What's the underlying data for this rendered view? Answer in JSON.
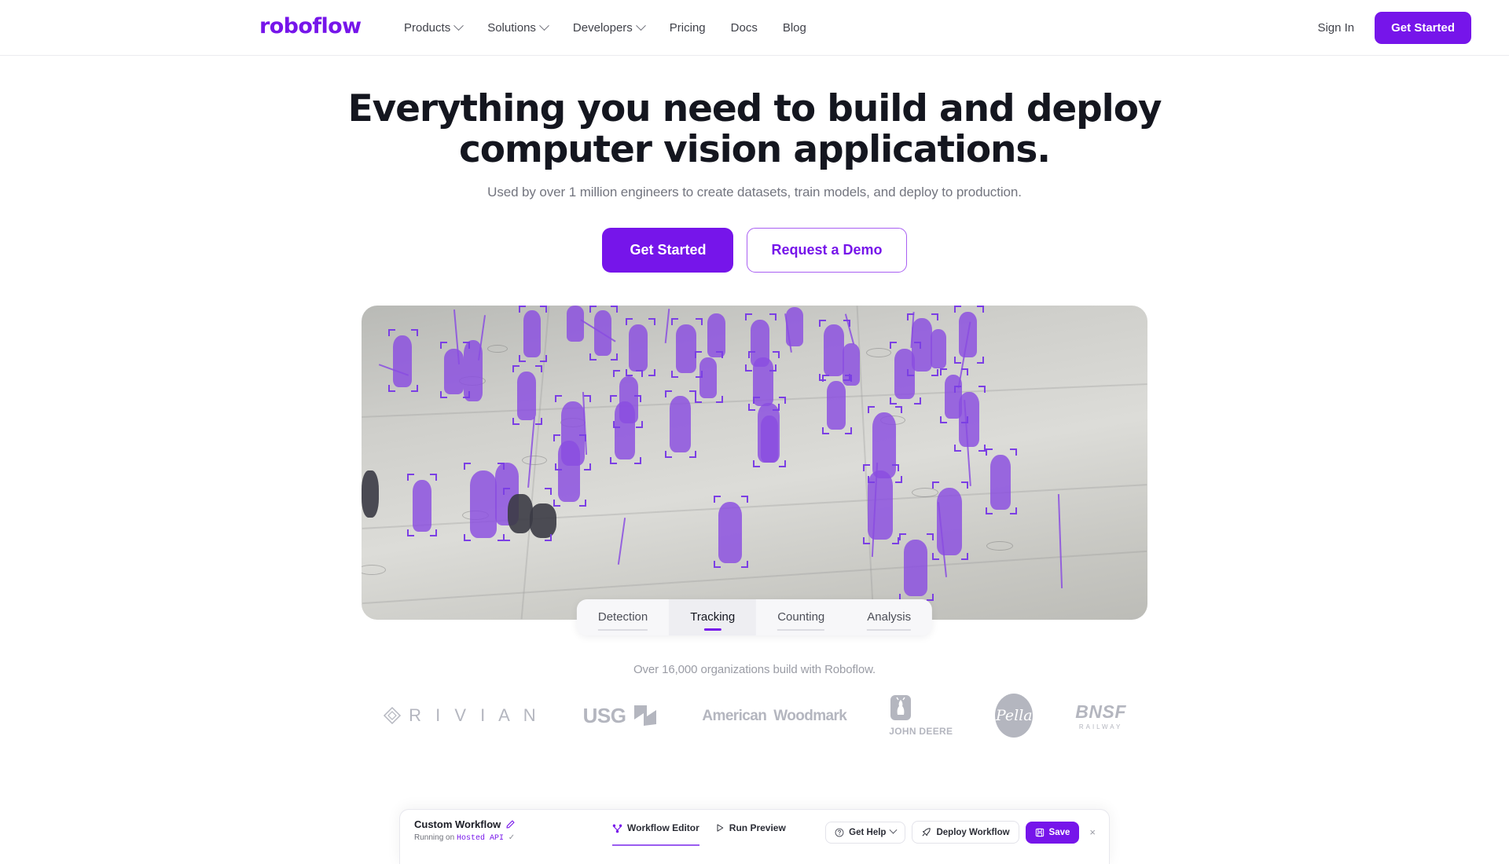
{
  "brand": {
    "logo_text": "roboflow",
    "accent": "#7615ea"
  },
  "nav": {
    "links": [
      {
        "label": "Products",
        "has_dropdown": true
      },
      {
        "label": "Solutions",
        "has_dropdown": true
      },
      {
        "label": "Developers",
        "has_dropdown": true
      },
      {
        "label": "Pricing",
        "has_dropdown": false
      },
      {
        "label": "Docs",
        "has_dropdown": false
      },
      {
        "label": "Blog",
        "has_dropdown": false
      }
    ],
    "sign_in": "Sign In",
    "get_started": "Get Started"
  },
  "hero": {
    "heading_line1": "Everything you need to build and deploy",
    "heading_line2": "computer vision applications.",
    "subheading": "Used by over 1 million engineers to create datasets, train models, and deploy to production.",
    "cta_primary": "Get Started",
    "cta_secondary": "Request a Demo"
  },
  "demo": {
    "tabs": [
      {
        "label": "Detection",
        "active": false
      },
      {
        "label": "Tracking",
        "active": true
      },
      {
        "label": "Counting",
        "active": false
      },
      {
        "label": "Analysis",
        "active": false
      }
    ],
    "scene_description": "Overhead surveillance view of a plaza with people segmented in purple and tracked with corner bounding boxes and motion trails"
  },
  "orgs": {
    "caption": "Over 16,000 organizations build with Roboflow.",
    "logos": [
      {
        "name": "Rivian",
        "text": "R I V I A N"
      },
      {
        "name": "USG",
        "text": "USG"
      },
      {
        "name": "American Woodmark",
        "line1": "American",
        "line2": "Woodmark"
      },
      {
        "name": "John Deere",
        "text": "JOHN DEERE"
      },
      {
        "name": "Pella",
        "text": "Pella"
      },
      {
        "name": "BNSF Railway",
        "text": "BNSF",
        "sub": "RAILWAY"
      }
    ]
  },
  "workflow": {
    "title": "Custom Workflow",
    "status_prefix": "Running on",
    "status_target": "Hosted API",
    "tabs": [
      {
        "label": "Workflow Editor",
        "active": true,
        "icon": "workflow-icon"
      },
      {
        "label": "Run Preview",
        "active": false,
        "icon": "play-icon"
      }
    ],
    "buttons": [
      {
        "label": "Get Help",
        "icon": "help-icon",
        "variant": "ghost",
        "caret": true
      },
      {
        "label": "Deploy Workflow",
        "icon": "rocket-icon",
        "variant": "ghost",
        "caret": false
      },
      {
        "label": "Save",
        "icon": "save-icon",
        "variant": "primary",
        "caret": false
      }
    ],
    "close_label": "×"
  }
}
